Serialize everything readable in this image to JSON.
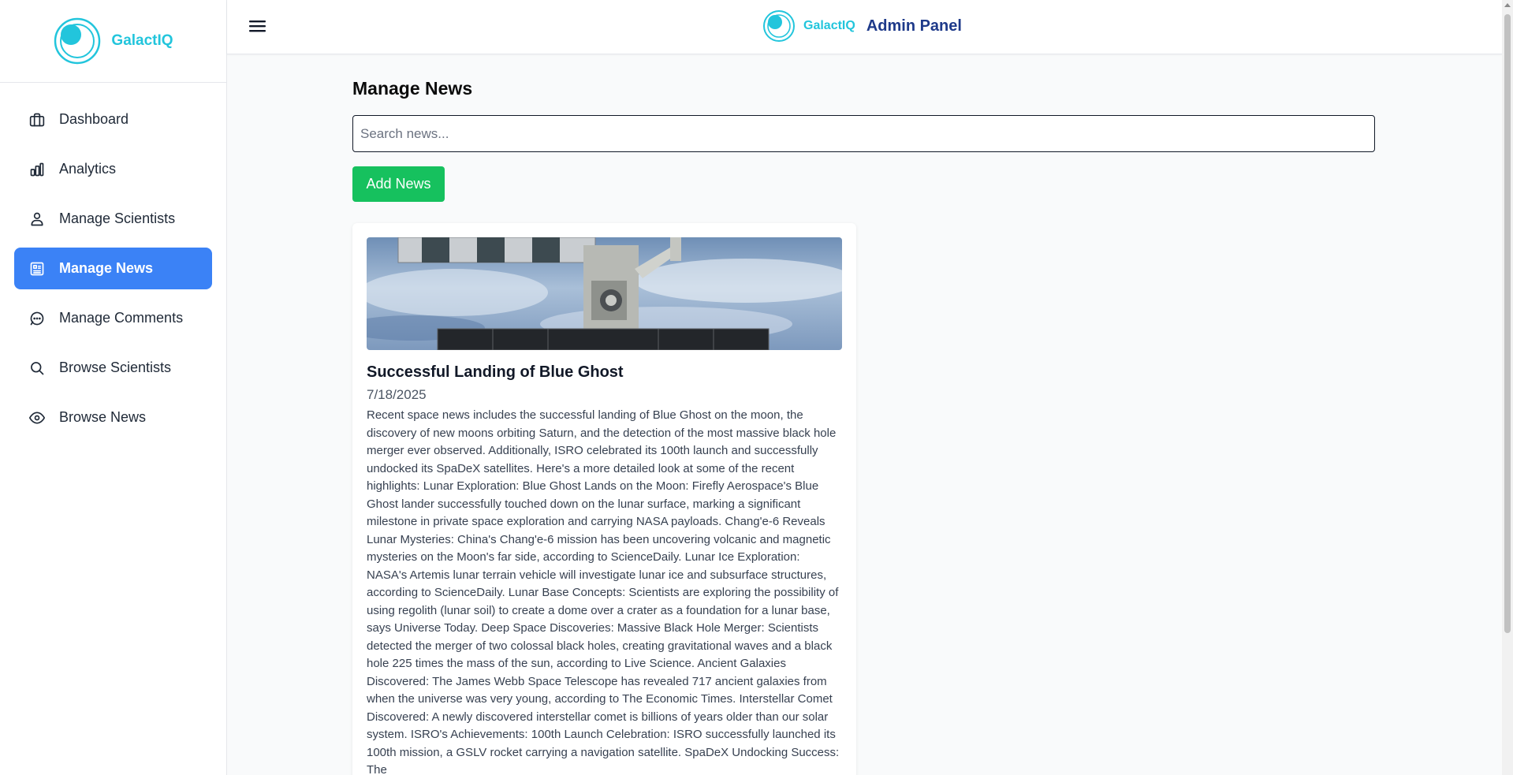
{
  "app": {
    "brand_name": "GalactIQ",
    "header_title": "Admin Panel",
    "accent_color": "#22c5dc",
    "active_color": "#3b82f6"
  },
  "sidebar": {
    "items": [
      {
        "label": "Dashboard",
        "icon": "briefcase-icon"
      },
      {
        "label": "Analytics",
        "icon": "bar-chart-icon"
      },
      {
        "label": "Manage Scientists",
        "icon": "user-icon"
      },
      {
        "label": "Manage News",
        "icon": "newspaper-icon",
        "active": true
      },
      {
        "label": "Manage Comments",
        "icon": "message-circle-icon"
      },
      {
        "label": "Browse Scientists",
        "icon": "search-icon"
      },
      {
        "label": "Browse News",
        "icon": "eye-icon"
      }
    ]
  },
  "main": {
    "title": "Manage News",
    "search_placeholder": "Search news...",
    "add_button_label": "Add News",
    "add_button_color": "#16c15e",
    "news": [
      {
        "title": "Successful Landing of Blue Ghost",
        "date": "7/18/2025",
        "image": "space-station-over-earth",
        "body": "Recent space news includes the successful landing of Blue Ghost on the moon, the discovery of new moons orbiting Saturn, and the detection of the most massive black hole merger ever observed. Additionally, ISRO celebrated its 100th launch and successfully undocked its SpaDeX satellites. Here's a more detailed look at some of the recent highlights: Lunar Exploration: Blue Ghost Lands on the Moon: Firefly Aerospace's Blue Ghost lander successfully touched down on the lunar surface, marking a significant milestone in private space exploration and carrying NASA payloads. Chang'e-6 Reveals Lunar Mysteries: China's Chang'e-6 mission has been uncovering volcanic and magnetic mysteries on the Moon's far side, according to ScienceDaily. Lunar Ice Exploration: NASA's Artemis lunar terrain vehicle will investigate lunar ice and subsurface structures, according to ScienceDaily. Lunar Base Concepts: Scientists are exploring the possibility of using regolith (lunar soil) to create a dome over a crater as a foundation for a lunar base, says Universe Today. Deep Space Discoveries: Massive Black Hole Merger: Scientists detected the merger of two colossal black holes, creating gravitational waves and a black hole 225 times the mass of the sun, according to Live Science. Ancient Galaxies Discovered: The James Webb Space Telescope has revealed 717 ancient galaxies from when the universe was very young, according to The Economic Times. Interstellar Comet Discovered: A newly discovered interstellar comet is billions of years older than our solar system. ISRO's Achievements: 100th Launch Celebration: ISRO successfully launched its 100th mission, a GSLV rocket carrying a navigation satellite. SpaDeX Undocking Success: The"
      }
    ]
  }
}
